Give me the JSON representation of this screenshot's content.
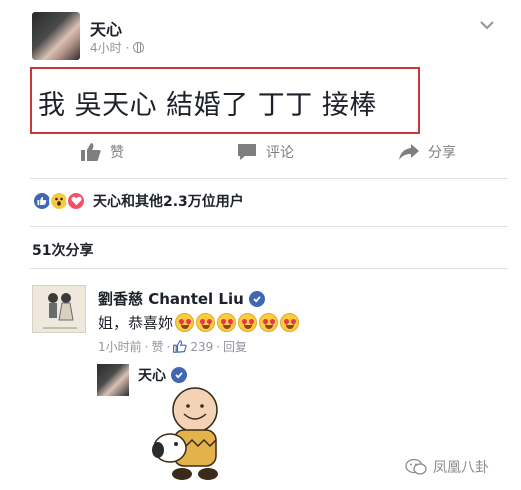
{
  "post": {
    "author": "天心",
    "time": "4小时",
    "separator": "·",
    "text": "我 吳天心 結婚了 丁丁 接棒",
    "highlight_color": "#c8373a"
  },
  "actions": {
    "like_label": "赞",
    "comment_label": "评论",
    "share_label": "分享"
  },
  "reactions": {
    "icons": [
      "like-icon",
      "wow-icon",
      "love-icon"
    ],
    "summary": "天心和其他2.3万位用户"
  },
  "shares": {
    "count_label": "51次分享"
  },
  "comment": {
    "author": "劉香慈 Chantel Liu",
    "text": "姐，恭喜妳",
    "emoji_count": 6,
    "time": "1小时前",
    "like_label": "赞",
    "like_count": "239",
    "reply_label": "回复",
    "separator": "·"
  },
  "reply": {
    "author": "天心"
  },
  "watermark": {
    "text": "凤凰八卦"
  },
  "colors": {
    "facebook_blue": "#4267b2",
    "text": "#1d2129",
    "meta": "#90949c"
  }
}
